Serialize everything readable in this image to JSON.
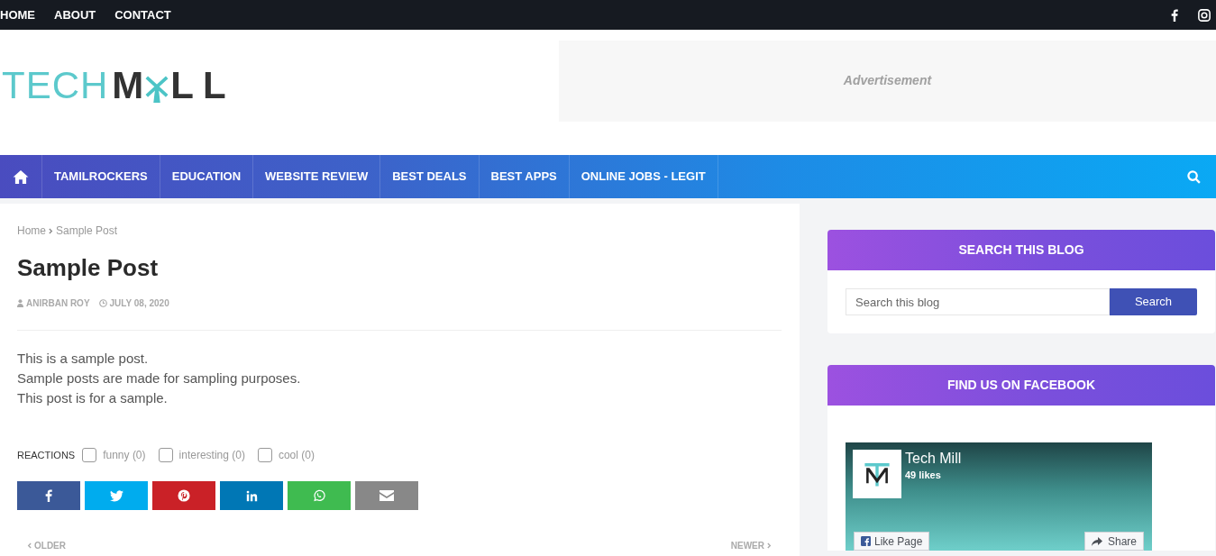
{
  "top_menu": [
    {
      "label": "HOME"
    },
    {
      "label": "ABOUT"
    },
    {
      "label": "CONTACT"
    }
  ],
  "social_links": [
    {
      "kind": "facebook"
    },
    {
      "kind": "instagram"
    }
  ],
  "logo": {
    "light_part": "TECH",
    "dark_part_start": "M",
    "dark_part_end": "LL"
  },
  "advertisement": {
    "label": "Advertisement"
  },
  "nav": {
    "items": [
      {
        "label": "TAMILROCKERS"
      },
      {
        "label": "EDUCATION"
      },
      {
        "label": "WEBSITE REVIEW"
      },
      {
        "label": "BEST DEALS"
      },
      {
        "label": "BEST APPS"
      },
      {
        "label": "ONLINE JOBS - LEGIT"
      }
    ]
  },
  "breadcrumb": {
    "home": "Home",
    "current": "Sample Post"
  },
  "post": {
    "title": "Sample Post",
    "author": "ANIRBAN ROY",
    "date": "JULY 08, 2020",
    "paragraphs": [
      "This is a sample post.",
      "Sample posts are made for sampling purposes.",
      "This post is for a sample."
    ]
  },
  "reactions": {
    "label": "REACTIONS",
    "options": [
      {
        "label": "funny (0)",
        "checked": false
      },
      {
        "label": "interesting (0)",
        "checked": false
      },
      {
        "label": "cool (0)",
        "checked": false
      }
    ]
  },
  "share_buttons": [
    {
      "kind": "facebook",
      "color": "#3b5998"
    },
    {
      "kind": "twitter",
      "color": "#00acee"
    },
    {
      "kind": "pinterest",
      "color": "#ca2127"
    },
    {
      "kind": "linkedin",
      "color": "#0077b5"
    },
    {
      "kind": "whatsapp",
      "color": "#3fbb50"
    },
    {
      "kind": "email",
      "color": "#888888"
    }
  ],
  "pager": {
    "older": "OLDER",
    "newer": "NEWER"
  },
  "sidebar": {
    "search_widget": {
      "title": "SEARCH THIS BLOG",
      "placeholder": "Search this blog",
      "button": "Search"
    },
    "facebook_widget": {
      "title": "FIND US ON FACEBOOK",
      "page_name": "Tech Mill",
      "likes": "49 likes",
      "like_button": "Like Page",
      "share_button": "Share"
    }
  }
}
